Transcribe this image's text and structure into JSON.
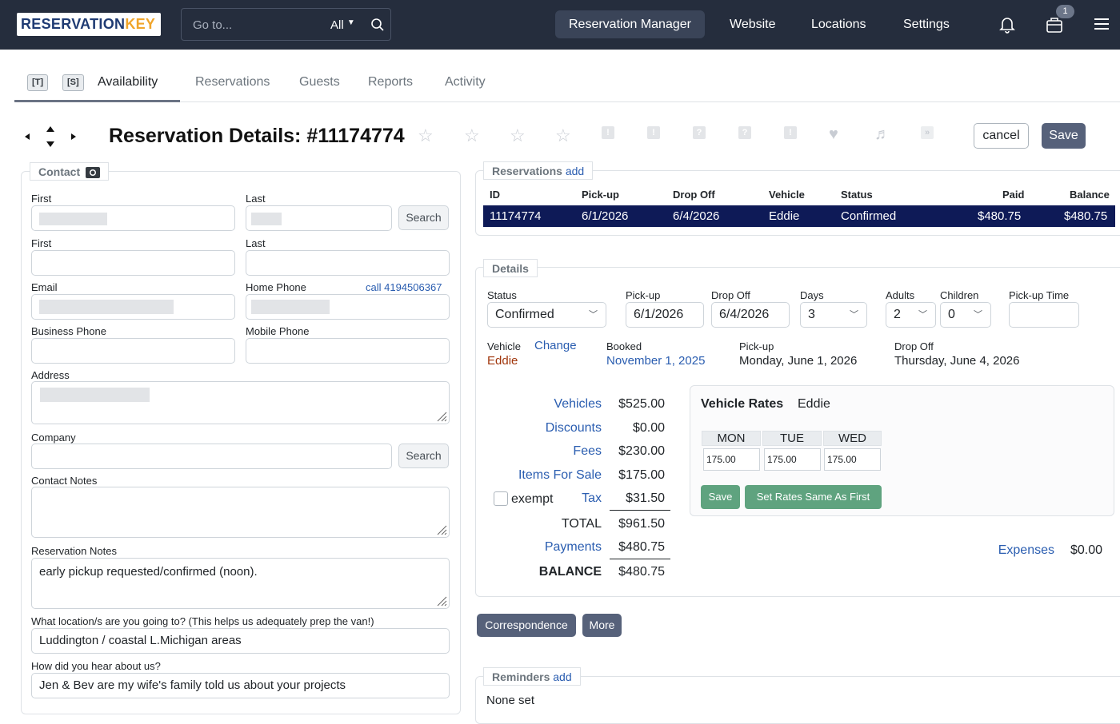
{
  "app": {
    "logo_left": "RESERVATION",
    "logo_right": "KEY",
    "search_placeholder": "Go to...",
    "search_scope": "All",
    "nav": [
      "Reservation Manager",
      "Website",
      "Locations",
      "Settings"
    ],
    "cart_count": "1"
  },
  "tabs": {
    "kbd_t": "[T]",
    "kbd_s": "[S]",
    "items": [
      "Availability",
      "Reservations",
      "Guests",
      "Reports",
      "Activity"
    ]
  },
  "header": {
    "title": "Reservation Details: #11174774",
    "flags": [
      "!",
      "!",
      "?",
      "?",
      "!"
    ],
    "cancel": "cancel",
    "save": "Save"
  },
  "contact": {
    "legend": "Contact",
    "first_label": "First",
    "last_label": "Last",
    "search": "Search",
    "first2_label": "First",
    "last2_label": "Last",
    "email_label": "Email",
    "home_phone_label": "Home Phone",
    "call_link": "call 4194506367",
    "business_phone_label": "Business Phone",
    "mobile_phone_label": "Mobile Phone",
    "address_label": "Address",
    "company_label": "Company",
    "company_search": "Search",
    "contact_notes_label": "Contact Notes",
    "reservation_notes_label": "Reservation Notes",
    "reservation_notes": "early pickup requested/confirmed (noon).",
    "location_q": "What location/s are you going to? (This helps us adequately prep the van!)",
    "location_a": "Luddington / coastal L.Michigan areas",
    "hear_q": "How did you hear about us?",
    "hear_a": "Jen & Bev are my wife's family told us about your projects"
  },
  "reservations": {
    "legend": "Reservations",
    "add": "add",
    "headers": [
      "ID",
      "Pick-up",
      "Drop Off",
      "Vehicle",
      "Status",
      "Paid",
      "Balance"
    ],
    "row": [
      "11174774",
      "6/1/2026",
      "6/4/2026",
      "Eddie",
      "Confirmed",
      "$480.75",
      "$480.75"
    ]
  },
  "details": {
    "legend": "Details",
    "status_label": "Status",
    "status": "Confirmed",
    "pickup_label": "Pick-up",
    "pickup": "6/1/2026",
    "dropoff_label": "Drop Off",
    "dropoff": "6/4/2026",
    "days_label": "Days",
    "days": "3",
    "adults_label": "Adults",
    "adults": "2",
    "children_label": "Children",
    "children": "0",
    "pickup_time_label": "Pick-up Time",
    "vehicle_label": "Vehicle",
    "change": "Change",
    "vehicle": "Eddie",
    "booked_label": "Booked",
    "booked": "November 1, 2025",
    "pickup_long_label": "Pick-up",
    "pickup_long": "Monday, June 1, 2026",
    "dropoff_long_label": "Drop Off",
    "dropoff_long": "Thursday, June 4, 2026"
  },
  "totals": {
    "vehicles_label": "Vehicles",
    "vehicles": "$525.00",
    "discounts_label": "Discounts",
    "discounts": "$0.00",
    "fees_label": "Fees",
    "fees": "$230.00",
    "items_label": "Items For Sale",
    "items": "$175.00",
    "exempt": "exempt",
    "tax_label": "Tax",
    "tax": "$31.50",
    "total_label": "TOTAL",
    "total": "$961.50",
    "payments_label": "Payments",
    "payments": "$480.75",
    "balance_label": "BALANCE",
    "balance": "$480.75",
    "expenses_label": "Expenses",
    "expenses": "$0.00"
  },
  "rates": {
    "title": "Vehicle Rates",
    "vehicle": "Eddie",
    "days": [
      "MON",
      "TUE",
      "WED"
    ],
    "values": [
      "175.00",
      "175.00",
      "175.00"
    ],
    "save": "Save",
    "same": "Set Rates Same As First"
  },
  "actions": {
    "correspondence": "Correspondence",
    "more": "More"
  },
  "reminders": {
    "legend": "Reminders",
    "add": "add",
    "none": "None set"
  }
}
